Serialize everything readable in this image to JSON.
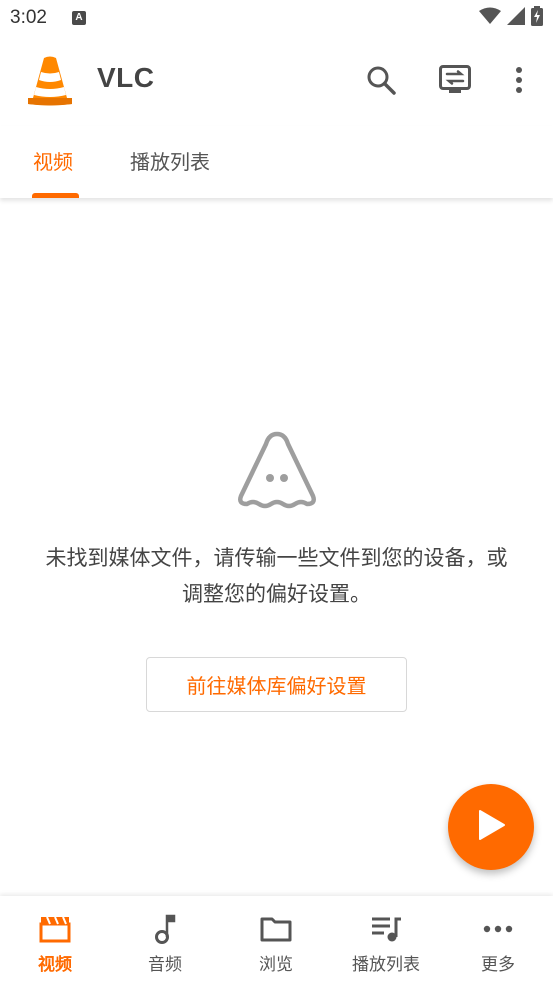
{
  "colors": {
    "accent": "#ff6a00",
    "text": "#444444",
    "icon": "#555555"
  },
  "status_bar": {
    "time": "3:02",
    "notification_icon": "a-badge-icon",
    "icons": [
      "wifi-icon",
      "signal-icon",
      "battery-charging-icon"
    ]
  },
  "app_bar": {
    "logo": "vlc-cone-icon",
    "title": "VLC",
    "actions": [
      "search-icon",
      "renderer-cast-icon",
      "overflow-menu-icon"
    ]
  },
  "tabs": [
    {
      "label": "视频",
      "active": true
    },
    {
      "label": "播放列表",
      "active": false
    }
  ],
  "empty_state": {
    "icon": "ghost-icon",
    "message_line1": "未找到媒体文件，请传输一些文件到您的设备，或",
    "message_line2": "调整您的偏好设置。",
    "button_label": "前往媒体库偏好设置"
  },
  "fab": {
    "icon": "play-icon"
  },
  "bottom_nav": [
    {
      "label": "视频",
      "icon": "clapperboard-icon",
      "active": true
    },
    {
      "label": "音频",
      "icon": "music-note-icon",
      "active": false
    },
    {
      "label": "浏览",
      "icon": "folder-icon",
      "active": false
    },
    {
      "label": "播放列表",
      "icon": "playlist-icon",
      "active": false
    },
    {
      "label": "更多",
      "icon": "more-dots-icon",
      "active": false
    }
  ]
}
